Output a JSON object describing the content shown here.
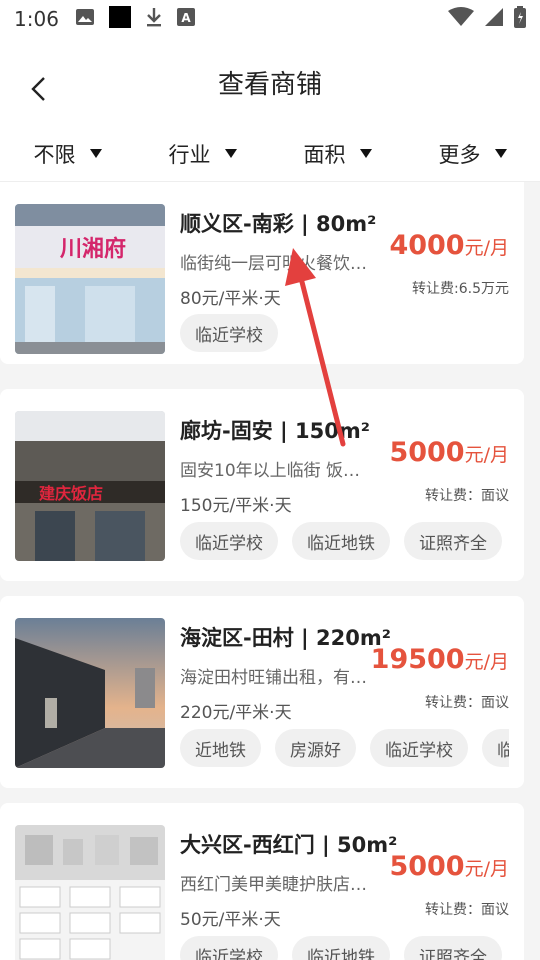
{
  "status_bar": {
    "time": "1:06",
    "icons": [
      "image-icon",
      "black-square-icon",
      "download-icon",
      "font-a-icon",
      "wifi-icon",
      "signal-icon",
      "battery-icon"
    ]
  },
  "header": {
    "title": "查看商铺"
  },
  "filters": [
    {
      "label": "不限"
    },
    {
      "label": "行业"
    },
    {
      "label": "面积"
    },
    {
      "label": "更多"
    }
  ],
  "listings": [
    {
      "title": "顺义区-南彩 | 80m²",
      "desc": "临街纯一层可明火餐饮…",
      "unit_price": "80元/平米·天",
      "price_num": "4000",
      "price_unit": "元/月",
      "transfer": "转让费:6.5万元",
      "tags": [
        "临近学校"
      ],
      "thumb_sign": "川湘府"
    },
    {
      "title": "廊坊-固安 | 150m²",
      "desc": "固安10年以上临街 饭…",
      "unit_price": "150元/平米·天",
      "price_num": "5000",
      "price_unit": "元/月",
      "transfer": "转让费：面议",
      "tags": [
        "临近学校",
        "临近地铁",
        "证照齐全"
      ],
      "thumb_sign": "建庆饭店"
    },
    {
      "title": "海淀区-田村 | 220m²",
      "desc": "海淀田村旺铺出租，有…",
      "unit_price": "220元/平米·天",
      "price_num": "19500",
      "price_unit": "元/月",
      "transfer": "转让费：面议",
      "tags": [
        "近地铁",
        "房源好",
        "临近学校",
        "临"
      ],
      "thumb_sign": ""
    },
    {
      "title": "大兴区-西红门 | 50m²",
      "desc": "西红门美甲美睫护肤店…",
      "unit_price": "50元/平米·天",
      "price_num": "5000",
      "price_unit": "元/月",
      "transfer": "转让费：面议",
      "tags": [
        "临近学校",
        "临近地铁",
        "证照齐全"
      ],
      "thumb_sign": ""
    }
  ],
  "colors": {
    "price_red": "#e5533d",
    "annotation_arrow": "#e3403e"
  }
}
